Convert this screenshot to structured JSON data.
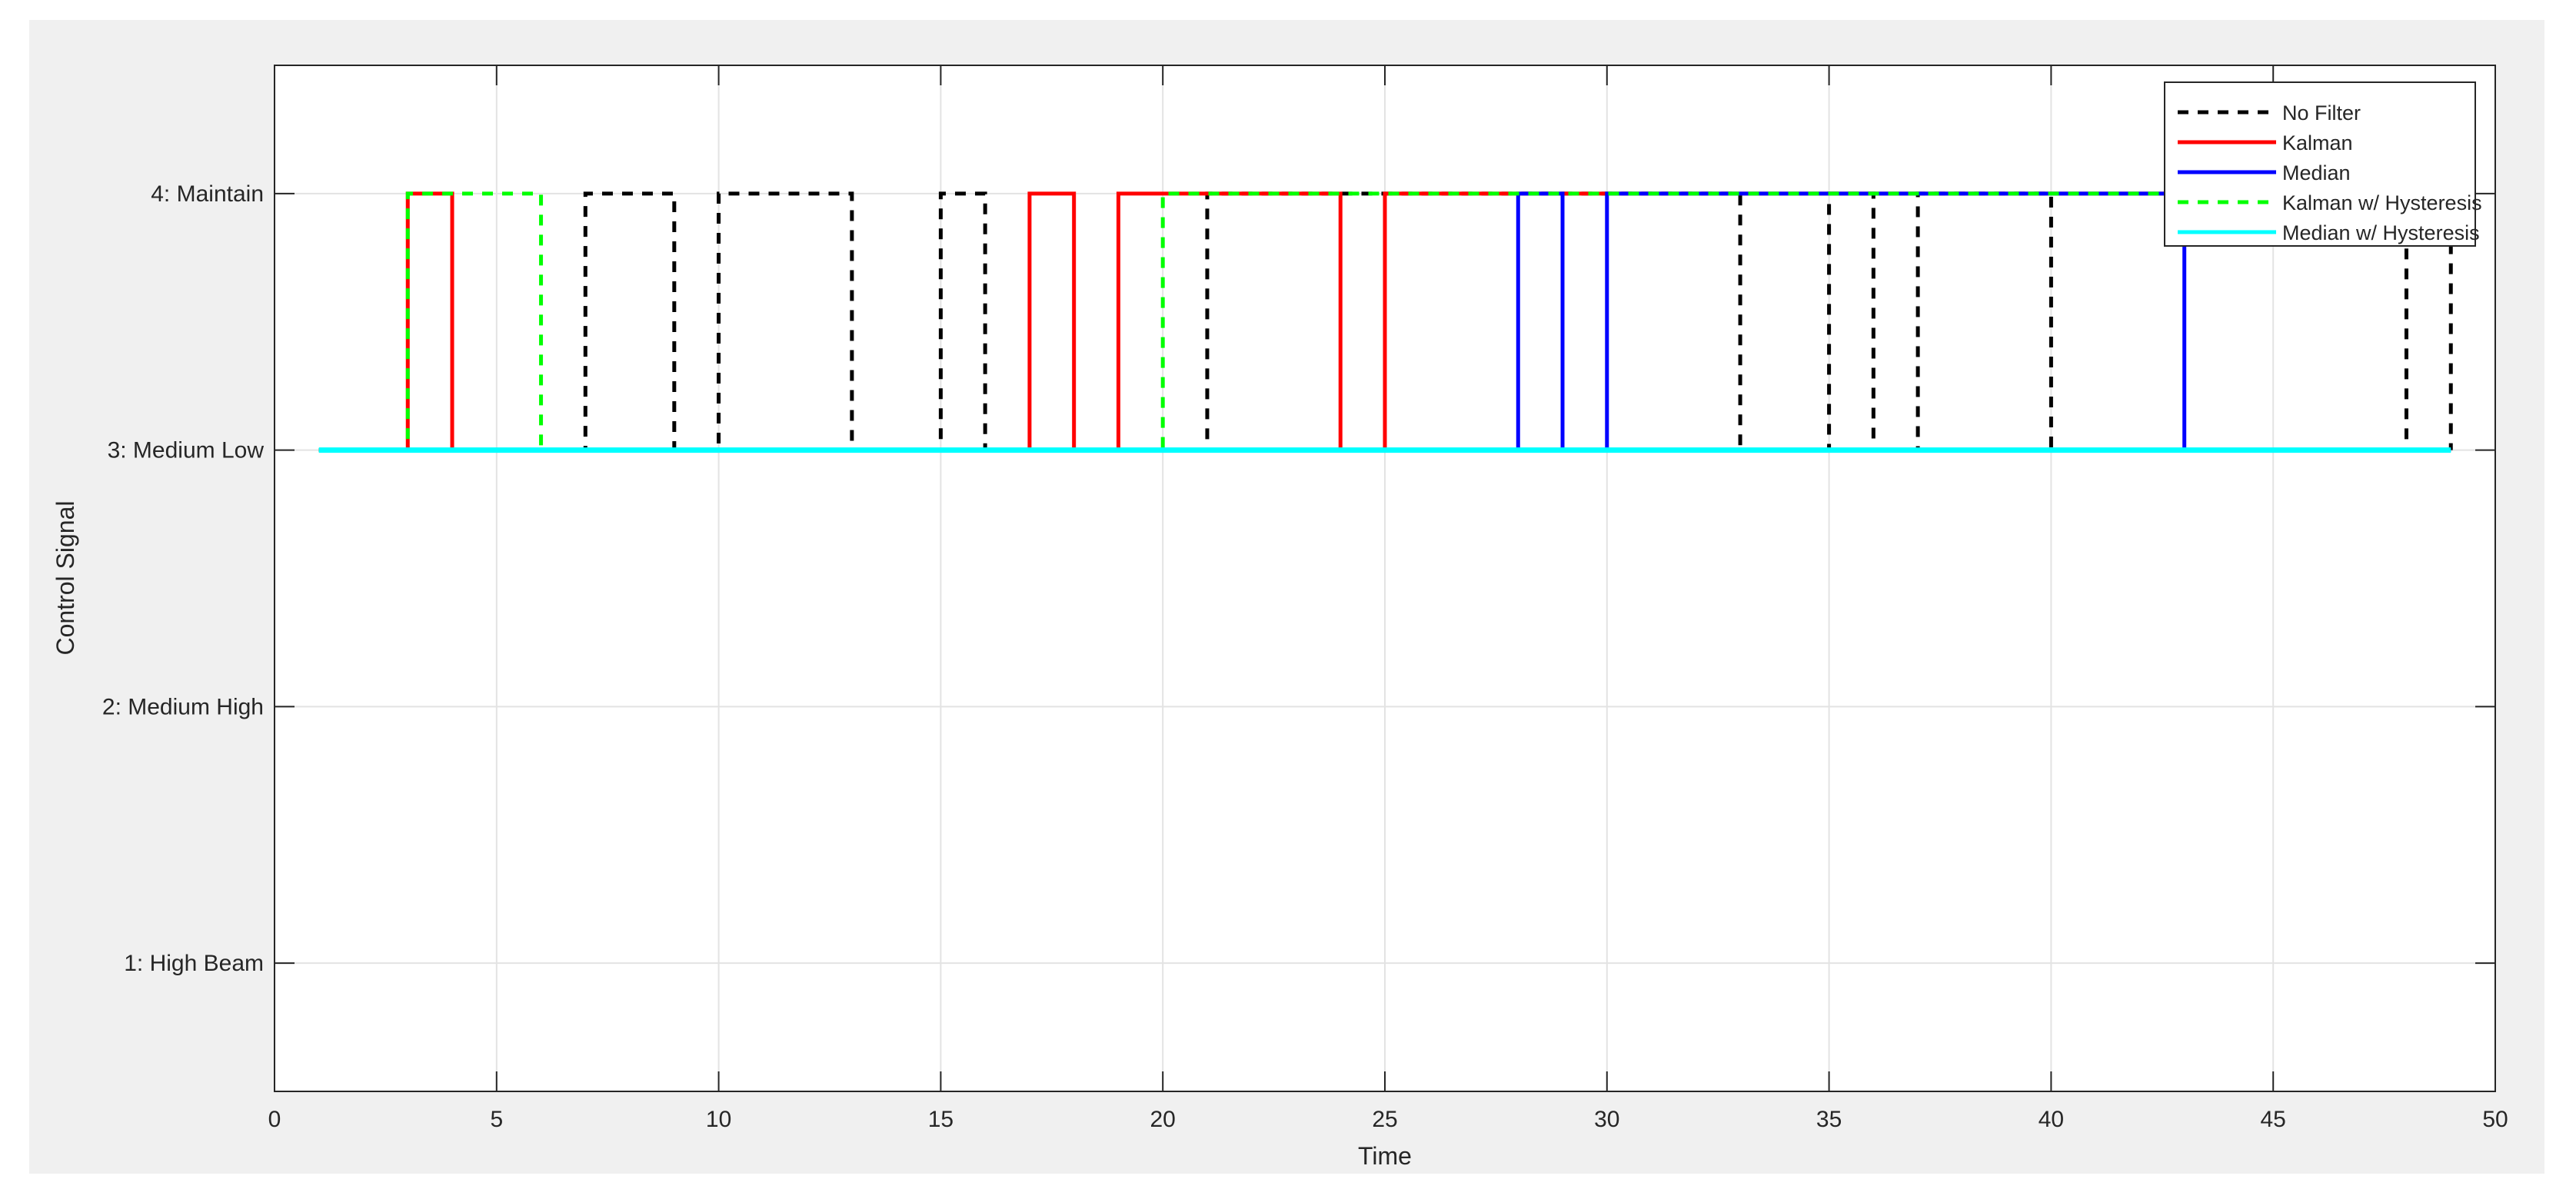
{
  "chart_data": {
    "type": "line",
    "title": "",
    "xlabel": "Time",
    "ylabel": "Control Signal",
    "xlim": [
      0,
      50
    ],
    "ylim": [
      0.5,
      4.5
    ],
    "grid": true,
    "legend_position": "top-right",
    "x_ticks": [
      0,
      5,
      10,
      15,
      20,
      25,
      30,
      35,
      40,
      45,
      50
    ],
    "y_ticks": [
      {
        "value": 1,
        "label": "1: High Beam"
      },
      {
        "value": 2,
        "label": "2: Medium High"
      },
      {
        "value": 3,
        "label": "3: Medium Low"
      },
      {
        "value": 4,
        "label": "4: Maintain"
      }
    ],
    "x": [
      1,
      2,
      3,
      4,
      5,
      6,
      7,
      8,
      9,
      10,
      11,
      12,
      13,
      14,
      15,
      16,
      17,
      18,
      19,
      20,
      21,
      22,
      23,
      24,
      25,
      26,
      27,
      28,
      29,
      30,
      31,
      32,
      33,
      34,
      35,
      36,
      37,
      38,
      39,
      40,
      41,
      42,
      43,
      44,
      45,
      46,
      47,
      48,
      49
    ],
    "series": [
      {
        "name": "No Filter",
        "color": "#000000",
        "dashed": true,
        "values": [
          3,
          3,
          3,
          3,
          3,
          3,
          4,
          4,
          3,
          4,
          4,
          4,
          3,
          3,
          4,
          3,
          3,
          3,
          3,
          3,
          4,
          4,
          4,
          4,
          4,
          4,
          4,
          4,
          4,
          4,
          4,
          4,
          3,
          3,
          4,
          3,
          4,
          4,
          4,
          3,
          3,
          3,
          3,
          3,
          3,
          3,
          3,
          4,
          3
        ]
      },
      {
        "name": "Kalman",
        "color": "#ff0000",
        "dashed": false,
        "values": [
          3,
          3,
          4,
          3,
          3,
          3,
          3,
          3,
          3,
          3,
          3,
          3,
          3,
          3,
          3,
          3,
          4,
          3,
          4,
          4,
          4,
          4,
          4,
          3,
          4,
          4,
          4,
          4,
          4,
          4,
          4,
          4,
          4,
          4,
          4,
          4,
          4,
          4,
          4,
          4,
          4,
          4,
          4,
          4,
          4,
          4,
          4,
          4,
          4
        ]
      },
      {
        "name": "Median",
        "color": "#0000ff",
        "dashed": false,
        "values": [
          3,
          3,
          3,
          3,
          3,
          3,
          3,
          3,
          3,
          3,
          3,
          3,
          3,
          3,
          3,
          3,
          3,
          3,
          3,
          3,
          3,
          3,
          3,
          3,
          3,
          3,
          3,
          4,
          3,
          4,
          4,
          4,
          4,
          4,
          4,
          4,
          4,
          4,
          4,
          4,
          4,
          4,
          3,
          3,
          3,
          3,
          3,
          3,
          3
        ]
      },
      {
        "name": "Kalman w/ Hysteresis",
        "color": "#00ff00",
        "dashed": true,
        "values": [
          3,
          3,
          4,
          4,
          4,
          3,
          3,
          3,
          3,
          3,
          3,
          3,
          3,
          3,
          3,
          3,
          3,
          3,
          3,
          4,
          4,
          4,
          4,
          4,
          4,
          4,
          4,
          4,
          4,
          4,
          4,
          4,
          4,
          4,
          4,
          4,
          4,
          4,
          4,
          4,
          4,
          4,
          4,
          4,
          4,
          4,
          4,
          4,
          4
        ]
      },
      {
        "name": "Median w/ Hysteresis",
        "color": "#00ffff",
        "dashed": false,
        "values": [
          3,
          3,
          3,
          3,
          3,
          3,
          3,
          3,
          3,
          3,
          3,
          3,
          3,
          3,
          3,
          3,
          3,
          3,
          3,
          3,
          3,
          3,
          3,
          3,
          3,
          3,
          3,
          3,
          3,
          3,
          3,
          3,
          3,
          3,
          3,
          3,
          3,
          3,
          3,
          3,
          3,
          3,
          3,
          3,
          3,
          3,
          3,
          3,
          3
        ]
      }
    ]
  }
}
